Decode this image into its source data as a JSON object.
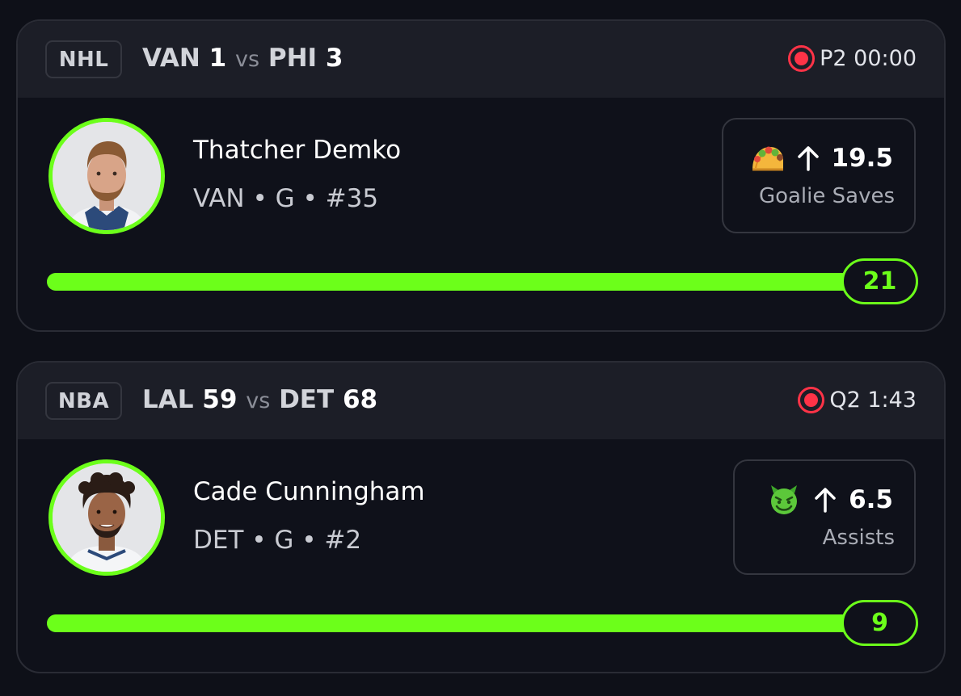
{
  "cards": [
    {
      "league": "NHL",
      "away_team": "VAN",
      "away_score": "1",
      "vs": "vs",
      "home_team": "PHI",
      "home_score": "3",
      "status": "P2 00:00",
      "status_icon": "live-icon",
      "player": {
        "name": "Thatcher Demko",
        "meta": "VAN • G • #35",
        "avatar": "player-headshot"
      },
      "prop": {
        "emoji": "taco-icon",
        "direction": "up-arrow-icon",
        "line": "19.5",
        "stat": "Goalie Saves"
      },
      "progress": {
        "current": "21",
        "fill_fraction": 1.0
      }
    },
    {
      "league": "NBA",
      "away_team": "LAL",
      "away_score": "59",
      "vs": "vs",
      "home_team": "DET",
      "home_score": "68",
      "status": "Q2 1:43",
      "status_icon": "live-icon",
      "player": {
        "name": "Cade Cunningham",
        "meta": "DET • G • #2",
        "avatar": "player-headshot"
      },
      "prop": {
        "emoji": "green-devil-icon",
        "direction": "up-arrow-icon",
        "line": "6.5",
        "stat": "Assists"
      },
      "progress": {
        "current": "9",
        "fill_fraction": 1.0
      }
    }
  ],
  "colors": {
    "background": "#0e1018",
    "header": "#1c1e27",
    "accent": "#6cff1a",
    "live": "#ff3347"
  }
}
